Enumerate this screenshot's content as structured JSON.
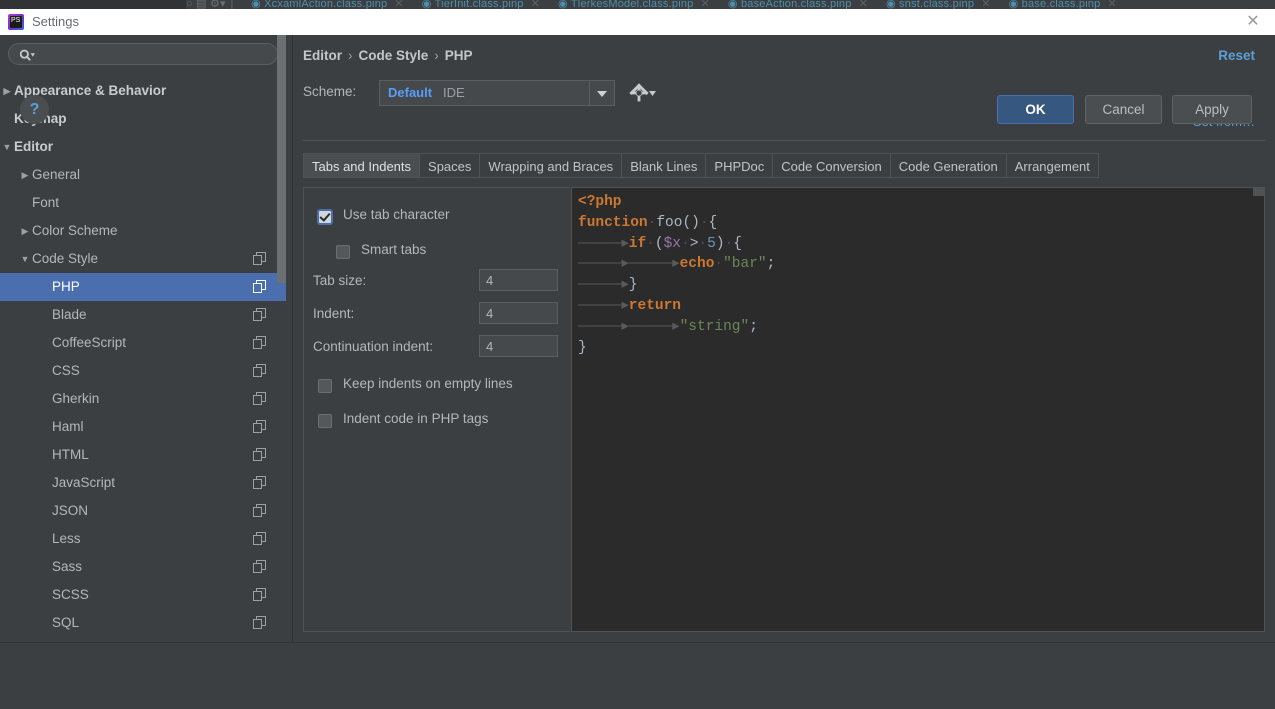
{
  "window": {
    "title": "Settings",
    "app_icon": "phpstorm-icon",
    "close_label": "✕"
  },
  "background_strip": {
    "tabs": [
      "XcxamlAction.class.pinp",
      "TierInit.class.pinp",
      "TlerkesModel.class.pinp",
      "baseAction.class.pinp",
      "snst.class.pinp",
      "base.class.pinp"
    ],
    "tab_close_glyph": "✕"
  },
  "search": {
    "placeholder": "",
    "value": "",
    "icon": "search-icon"
  },
  "sidebar": {
    "items": [
      {
        "label": "Appearance & Behavior",
        "indent": 0,
        "twisty": "collapsed",
        "bold": true,
        "copy": false,
        "selected": false
      },
      {
        "label": "Keymap",
        "indent": 0,
        "twisty": "none",
        "bold": true,
        "copy": false,
        "selected": false
      },
      {
        "label": "Editor",
        "indent": 0,
        "twisty": "expanded",
        "bold": true,
        "copy": false,
        "selected": false
      },
      {
        "label": "General",
        "indent": 1,
        "twisty": "collapsed",
        "bold": false,
        "copy": false,
        "selected": false
      },
      {
        "label": "Font",
        "indent": 1,
        "twisty": "none",
        "bold": false,
        "copy": false,
        "selected": false
      },
      {
        "label": "Color Scheme",
        "indent": 1,
        "twisty": "collapsed",
        "bold": false,
        "copy": false,
        "selected": false
      },
      {
        "label": "Code Style",
        "indent": 1,
        "twisty": "expanded",
        "bold": false,
        "copy": true,
        "selected": false
      },
      {
        "label": "PHP",
        "indent": 2,
        "twisty": "none",
        "bold": false,
        "copy": true,
        "selected": true
      },
      {
        "label": "Blade",
        "indent": 2,
        "twisty": "none",
        "bold": false,
        "copy": true,
        "selected": false
      },
      {
        "label": "CoffeeScript",
        "indent": 2,
        "twisty": "none",
        "bold": false,
        "copy": true,
        "selected": false
      },
      {
        "label": "CSS",
        "indent": 2,
        "twisty": "none",
        "bold": false,
        "copy": true,
        "selected": false
      },
      {
        "label": "Gherkin",
        "indent": 2,
        "twisty": "none",
        "bold": false,
        "copy": true,
        "selected": false
      },
      {
        "label": "Haml",
        "indent": 2,
        "twisty": "none",
        "bold": false,
        "copy": true,
        "selected": false
      },
      {
        "label": "HTML",
        "indent": 2,
        "twisty": "none",
        "bold": false,
        "copy": true,
        "selected": false
      },
      {
        "label": "JavaScript",
        "indent": 2,
        "twisty": "none",
        "bold": false,
        "copy": true,
        "selected": false
      },
      {
        "label": "JSON",
        "indent": 2,
        "twisty": "none",
        "bold": false,
        "copy": true,
        "selected": false
      },
      {
        "label": "Less",
        "indent": 2,
        "twisty": "none",
        "bold": false,
        "copy": true,
        "selected": false
      },
      {
        "label": "Sass",
        "indent": 2,
        "twisty": "none",
        "bold": false,
        "copy": true,
        "selected": false
      },
      {
        "label": "SCSS",
        "indent": 2,
        "twisty": "none",
        "bold": false,
        "copy": true,
        "selected": false
      },
      {
        "label": "SQL",
        "indent": 2,
        "twisty": "none",
        "bold": false,
        "copy": true,
        "selected": false
      }
    ]
  },
  "content": {
    "breadcrumb": [
      "Editor",
      "Code Style",
      "PHP"
    ],
    "breadcrumb_separator": "›",
    "reset_label": "Reset",
    "scheme_label": "Scheme:",
    "scheme_value": "Default",
    "scheme_suffix": "IDE",
    "gear_icon": "gear-icon",
    "set_from_label": "Set from…",
    "tabs": [
      {
        "label": "Tabs and Indents",
        "active": true
      },
      {
        "label": "Spaces",
        "active": false
      },
      {
        "label": "Wrapping and Braces",
        "active": false
      },
      {
        "label": "Blank Lines",
        "active": false
      },
      {
        "label": "PHPDoc",
        "active": false
      },
      {
        "label": "Code Conversion",
        "active": false
      },
      {
        "label": "Code Generation",
        "active": false
      },
      {
        "label": "Arrangement",
        "active": false
      }
    ]
  },
  "options": {
    "use_tab_character": {
      "label": "Use tab character",
      "checked": true
    },
    "smart_tabs": {
      "label": "Smart tabs",
      "checked": false
    },
    "tab_size": {
      "label": "Tab size:",
      "value": "4"
    },
    "indent": {
      "label": "Indent:",
      "value": "4"
    },
    "continuation_indent": {
      "label": "Continuation indent:",
      "value": "4"
    },
    "keep_indents": {
      "label": "Keep indents on empty lines",
      "checked": false
    },
    "indent_php_tags": {
      "label": "Indent code in PHP tags",
      "checked": false
    }
  },
  "preview": {
    "language": "php",
    "lines": [
      {
        "tokens": [
          {
            "t": "<?php",
            "c": "kw"
          }
        ]
      },
      {
        "tokens": [
          {
            "t": "function",
            "c": "kw"
          },
          {
            "t": "·",
            "c": "dot"
          },
          {
            "t": "foo",
            "c": "fn"
          },
          {
            "t": "()",
            "c": "pun"
          },
          {
            "t": "·",
            "c": "dot"
          },
          {
            "t": "{",
            "c": "pun"
          }
        ]
      },
      {
        "tokens": [
          {
            "t": "→",
            "c": "ws",
            "tab": 1
          },
          {
            "t": "if",
            "c": "kw"
          },
          {
            "t": "·",
            "c": "dot"
          },
          {
            "t": "(",
            "c": "pun"
          },
          {
            "t": "$x",
            "c": "var"
          },
          {
            "t": "·",
            "c": "dot"
          },
          {
            "t": ">",
            "c": "pun"
          },
          {
            "t": "·",
            "c": "dot"
          },
          {
            "t": "5",
            "c": "num"
          },
          {
            "t": ")",
            "c": "pun"
          },
          {
            "t": "·",
            "c": "dot"
          },
          {
            "t": "{",
            "c": "pun"
          }
        ]
      },
      {
        "tokens": [
          {
            "t": "→",
            "c": "ws",
            "tab": 2
          },
          {
            "t": "echo",
            "c": "kw"
          },
          {
            "t": "·",
            "c": "dot"
          },
          {
            "t": "\"bar\"",
            "c": "str"
          },
          {
            "t": ";",
            "c": "pun"
          }
        ]
      },
      {
        "tokens": [
          {
            "t": "→",
            "c": "ws",
            "tab": 1
          },
          {
            "t": "}",
            "c": "pun"
          }
        ]
      },
      {
        "tokens": [
          {
            "t": "→",
            "c": "ws",
            "tab": 1
          },
          {
            "t": "return",
            "c": "kw"
          }
        ]
      },
      {
        "tokens": [
          {
            "t": "→",
            "c": "ws",
            "tab": 2
          },
          {
            "t": "\"string\"",
            "c": "str"
          },
          {
            "t": ";",
            "c": "pun"
          }
        ]
      },
      {
        "tokens": [
          {
            "t": "}",
            "c": "pun"
          }
        ]
      }
    ],
    "raw_text": "<?php\nfunction foo() {\n\tif ($x > 5) {\n\t\techo \"bar\";\n\t}\n\treturn\n\t\t\"string\";\n}"
  },
  "footer": {
    "help_label": "?",
    "ok_label": "OK",
    "cancel_label": "Cancel",
    "apply_label": "Apply"
  },
  "colors": {
    "dialog_bg": "#3c3f41",
    "editor_bg": "#2b2b2b",
    "accent_blue": "#4b6eaf",
    "link_blue": "#5c9fd6",
    "selection_blue": "#4b6eaf",
    "keyword_orange": "#cc7832",
    "string_green": "#6a8759",
    "number_blue": "#6897bb",
    "variable_purple": "#9876aa",
    "text_gray": "#b4b7ba"
  }
}
